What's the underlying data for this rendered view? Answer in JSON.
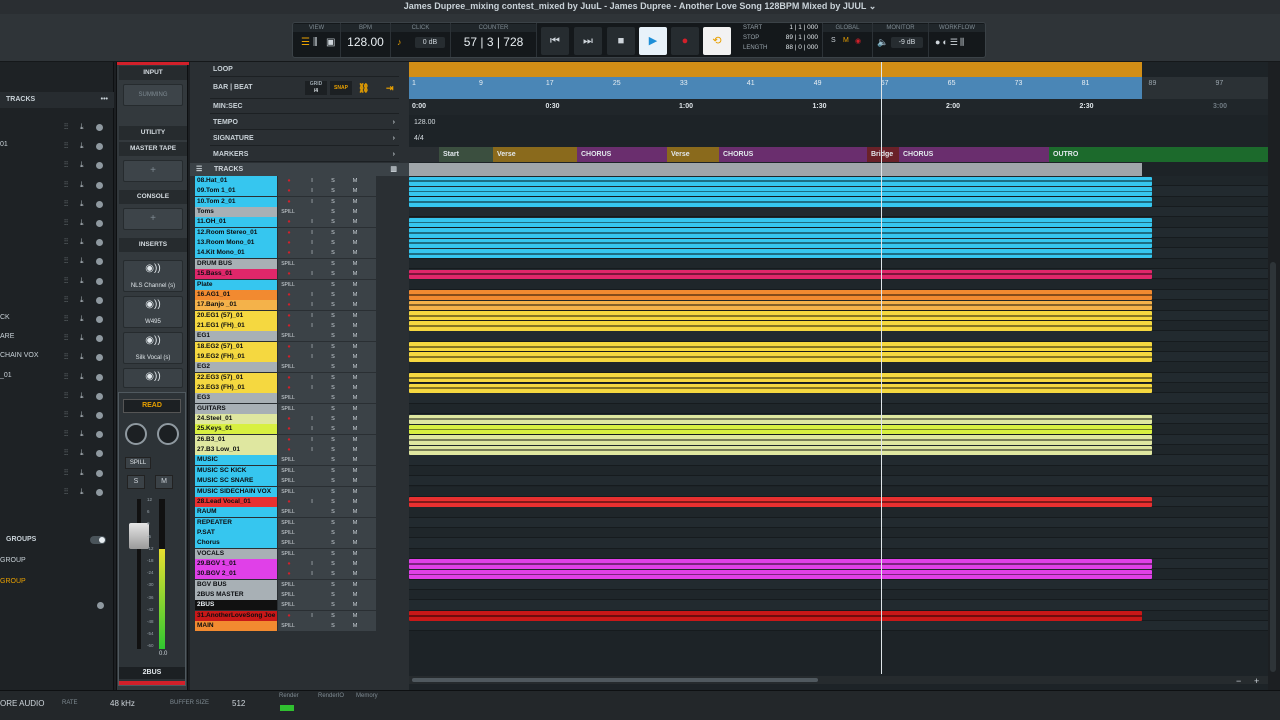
{
  "window": {
    "title": "James Dupree_mixing contest_mixed by JuuL - James Dupree - Another Love Song 128BPM Mixed by JUUL ⌄"
  },
  "transport": {
    "view_label": "VIEW",
    "bpm_label": "BPM",
    "bpm": "128.00",
    "click_label": "CLICK",
    "click_db": "0 dB",
    "counter_label": "COUNTER",
    "counter": "57 | 3 | 728",
    "start_label": "START",
    "stop_label": "STOP",
    "length_label": "LENGTH",
    "start": "1 | 1 | 000",
    "stop": "89 | 1 | 000",
    "length": "88 | 0 | 000",
    "global_label": "GLOBAL",
    "monitor_label": "MONITOR",
    "monitor_db": "-9 dB",
    "workflow_label": "WORKFLOW"
  },
  "left_panel": {
    "tracks_label": "TRACKS",
    "groups_label": "GROUPS",
    "rows": [
      "",
      "01",
      "",
      "",
      "",
      "",
      "",
      "",
      "",
      "",
      "CK",
      "ARE",
      "CHAIN VOX",
      "_01",
      "",
      "",
      "",
      "",
      "",
      ""
    ],
    "group_items": [
      "GROUP",
      "GROUP"
    ]
  },
  "strip": {
    "input": "INPUT",
    "summing": "SUMMING",
    "utility": "UTILITY",
    "master_tape": "MASTER TAPE",
    "console": "CONSOLE",
    "inserts": "INSERTS",
    "plugins": [
      "NLS Channel (s)",
      "W495",
      "Silk Vocal (s)"
    ],
    "read": "READ",
    "spill": "SPILL",
    "s": "S",
    "m": "M",
    "value": "0.0",
    "name": "2BUS",
    "scale": [
      "12",
      "6",
      "0",
      "-6",
      "-12",
      "-18",
      "-24",
      "-30",
      "-36",
      "-42",
      "-48",
      "-54",
      "-60"
    ]
  },
  "rulers": {
    "loop": "LOOP",
    "bar_beat": "BAR | BEAT",
    "grid": "GRID",
    "grid_val": "/4",
    "snap": "SNAP",
    "minsec": "MIN:SEC",
    "tempo": "TEMPO",
    "tempo_val": "128.00",
    "signature": "SIGNATURE",
    "signature_val": "4/4",
    "markers": "MARKERS",
    "tracks": "TRACKS"
  },
  "bar_ticks": [
    "1",
    "9",
    "17",
    "25",
    "33",
    "41",
    "49",
    "57",
    "65",
    "73",
    "81",
    "89",
    "97"
  ],
  "sec_ticks": [
    "0:00",
    "0:30",
    "1:00",
    "1:30",
    "2:00",
    "2:30",
    "3:00"
  ],
  "markers": [
    {
      "label": "Start",
      "color": "#3b4f3f"
    },
    {
      "label": "Verse",
      "color": "#8a6a1c"
    },
    {
      "label": "CHORUS",
      "color": "#6a2e6e"
    },
    {
      "label": "Verse",
      "color": "#8a6a1c"
    },
    {
      "label": "CHORUS",
      "color": "#6a2e6e"
    },
    {
      "label": "Bridge",
      "color": "#6a2128"
    },
    {
      "label": "CHORUS",
      "color": "#6a2e6e"
    },
    {
      "label": "OUTRO",
      "color": "#1c6a2c"
    }
  ],
  "tracks": [
    {
      "name": "08.Hat_01",
      "color": "#36c6ef",
      "type": "audio"
    },
    {
      "name": "09.Tom 1_01",
      "color": "#36c6ef",
      "type": "audio"
    },
    {
      "name": "10.Tom 2_01",
      "color": "#36c6ef",
      "type": "audio"
    },
    {
      "name": "Toms",
      "color": "#a8b0b5",
      "type": "bus"
    },
    {
      "name": "11.OH_01",
      "color": "#36c6ef",
      "type": "audio"
    },
    {
      "name": "12.Room Stereo_01",
      "color": "#36c6ef",
      "type": "audio"
    },
    {
      "name": "13.Room Mono_01",
      "color": "#36c6ef",
      "type": "audio"
    },
    {
      "name": "14.Kit Mono_01",
      "color": "#36c6ef",
      "type": "audio"
    },
    {
      "name": "DRUM BUS",
      "color": "#a8b0b5",
      "type": "bus"
    },
    {
      "name": "15.Bass_01",
      "color": "#e0276a",
      "type": "audio"
    },
    {
      "name": "Plate",
      "color": "#36c6ef",
      "type": "bus"
    },
    {
      "name": "16.AG1_01",
      "color": "#f28a30",
      "type": "audio"
    },
    {
      "name": "17.Banjo _01",
      "color": "#f4b24a",
      "type": "audio"
    },
    {
      "name": "20.EG1 (57)_01",
      "color": "#f5d840",
      "type": "audio"
    },
    {
      "name": "21.EG1 (FH)_01",
      "color": "#f5d840",
      "type": "audio"
    },
    {
      "name": "EG1",
      "color": "#a8b0b5",
      "type": "bus"
    },
    {
      "name": "18.EG2 (57)_01",
      "color": "#f5d840",
      "type": "audio"
    },
    {
      "name": "19.EG2 (FH)_01",
      "color": "#f5d840",
      "type": "audio"
    },
    {
      "name": "EG2",
      "color": "#a8b0b5",
      "type": "bus"
    },
    {
      "name": "22.EG3 (57)_01",
      "color": "#f5d840",
      "type": "audio"
    },
    {
      "name": "23.EG3 (FH)_01",
      "color": "#f5d840",
      "type": "audio"
    },
    {
      "name": "EG3",
      "color": "#a8b0b5",
      "type": "bus"
    },
    {
      "name": "GUITARS",
      "color": "#a8b0b5",
      "type": "bus"
    },
    {
      "name": "24.Steel_01",
      "color": "#dfe7a0",
      "type": "audio"
    },
    {
      "name": "25.Keys_01",
      "color": "#d8f040",
      "type": "audio"
    },
    {
      "name": "26.B3_01",
      "color": "#dfe7a0",
      "type": "audio"
    },
    {
      "name": "27.B3 Low_01",
      "color": "#dfe7a0",
      "type": "audio"
    },
    {
      "name": "MUSIC",
      "color": "#36c6ef",
      "type": "bus"
    },
    {
      "name": "MUSIC SC KICK",
      "color": "#36c6ef",
      "type": "bus"
    },
    {
      "name": "MUSIC SC SNARE",
      "color": "#36c6ef",
      "type": "bus"
    },
    {
      "name": "MUSIC SIDECHAIN VOX",
      "color": "#36c6ef",
      "type": "bus"
    },
    {
      "name": "28.Lead Vocal_01",
      "color": "#e83030",
      "type": "audio"
    },
    {
      "name": "RAUM",
      "color": "#36c6ef",
      "type": "bus"
    },
    {
      "name": "REPEATER",
      "color": "#36c6ef",
      "type": "bus"
    },
    {
      "name": "P.SAT",
      "color": "#36c6ef",
      "type": "bus"
    },
    {
      "name": "Chorus",
      "color": "#36c6ef",
      "type": "bus"
    },
    {
      "name": "VOCALS",
      "color": "#a8b0b5",
      "type": "bus"
    },
    {
      "name": "29.BGV 1_01",
      "color": "#e040e8",
      "type": "audio"
    },
    {
      "name": "30.BGV 2_01",
      "color": "#e040e8",
      "type": "audio"
    },
    {
      "name": "BGV BUS",
      "color": "#a8b0b5",
      "type": "bus"
    },
    {
      "name": "2BUS MASTER",
      "color": "#a8b0b5",
      "type": "bus"
    },
    {
      "name": "2BUS",
      "color": "#111111",
      "type": "bus"
    },
    {
      "name": "31.AnotherLoveSong Joe MIX_01",
      "color": "#c81818",
      "type": "audio"
    },
    {
      "name": "MAIN",
      "color": "#f28a30",
      "type": "bus"
    }
  ],
  "row_labels": {
    "spill": "SPILL",
    "s": "S",
    "m": "M",
    "i": "I",
    "r": "●"
  },
  "status": {
    "device": "ORE AUDIO",
    "rate_label": "RATE",
    "rate": "48 kHz",
    "buffer_label": "BUFFER SIZE",
    "buffer": "512",
    "render_label": "Render",
    "render_io_label": "RenderIO",
    "memory_label": "Memory"
  }
}
